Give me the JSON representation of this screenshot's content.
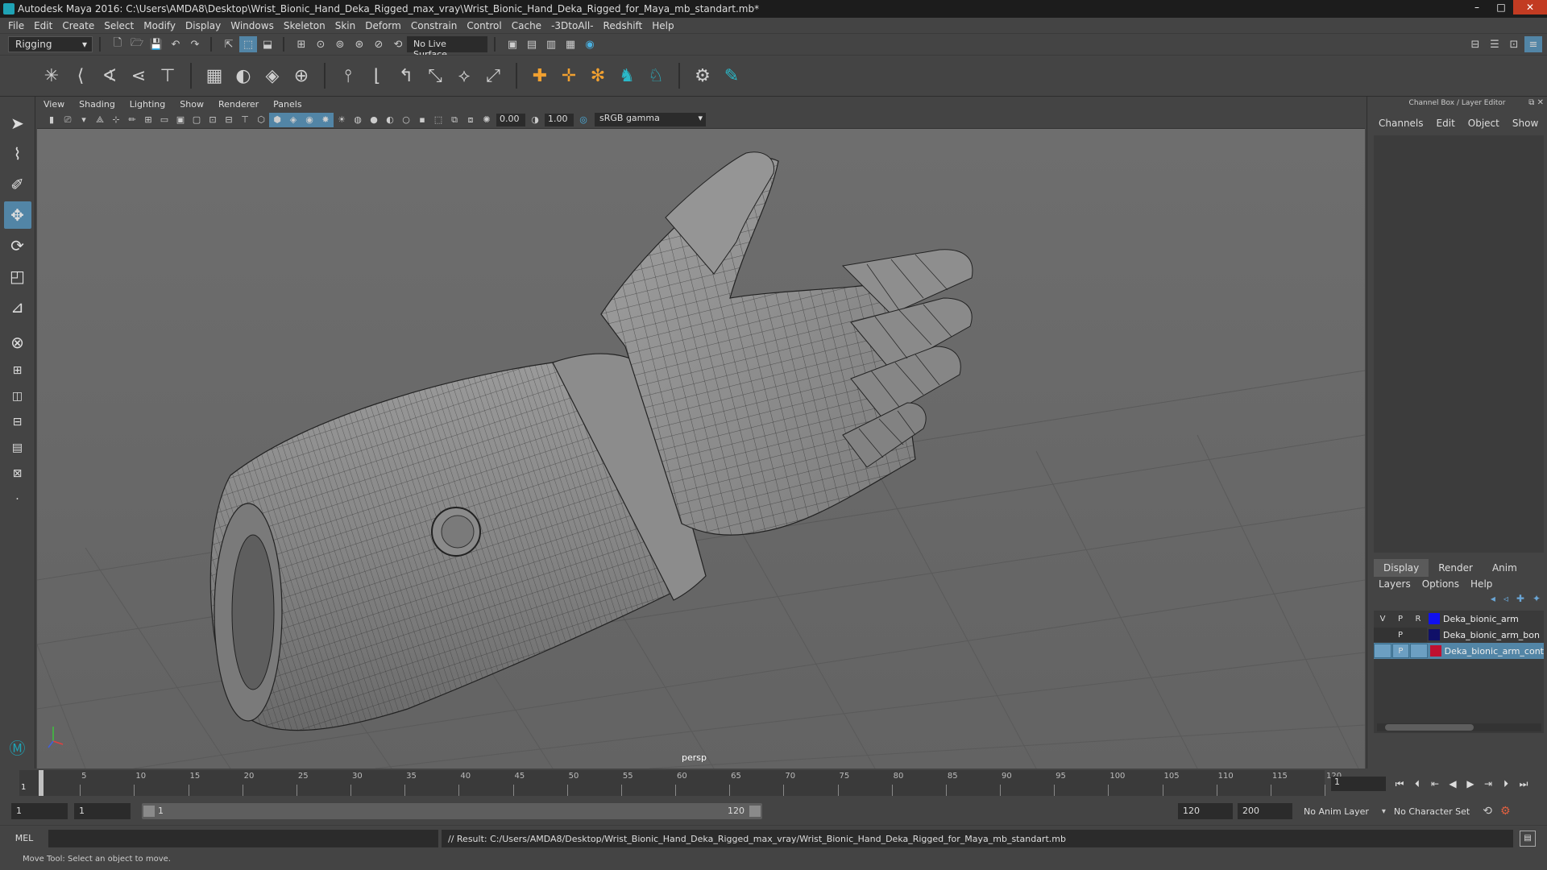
{
  "window": {
    "title": "Autodesk Maya 2016: C:\\Users\\AMDA8\\Desktop\\Wrist_Bionic_Hand_Deka_Rigged_max_vray\\Wrist_Bionic_Hand_Deka_Rigged_for_Maya_mb_standart.mb*",
    "minimize": "–",
    "maximize": "□",
    "close": "✕"
  },
  "menus": [
    "File",
    "Edit",
    "Create",
    "Select",
    "Modify",
    "Display",
    "Windows",
    "Skeleton",
    "Skin",
    "Deform",
    "Constrain",
    "Control",
    "Cache",
    "-3DtoAll-",
    "Redshift",
    "Help"
  ],
  "status_line": {
    "mode": "Rigging",
    "live_surface": "No Live Surface"
  },
  "viewport": {
    "menus": [
      "View",
      "Shading",
      "Lighting",
      "Show",
      "Renderer",
      "Panels"
    ],
    "exposure": "0.00",
    "gamma": "1.00",
    "color_space": "sRGB gamma",
    "camera": "persp"
  },
  "channel_box": {
    "header": "Channel Box / Layer Editor",
    "tabs": [
      "Channels",
      "Edit",
      "Object",
      "Show"
    ]
  },
  "layer_editor": {
    "tabs": [
      "Display",
      "Render",
      "Anim"
    ],
    "active_tab": "Display",
    "menus": [
      "Layers",
      "Options",
      "Help"
    ],
    "layers": [
      {
        "v": "V",
        "p": "P",
        "r": "R",
        "color": "#1010f0",
        "name": "Deka_bionic_arm",
        "selected": false
      },
      {
        "v": "",
        "p": "P",
        "r": "",
        "color": "#101068",
        "name": "Deka_bionic_arm_bon",
        "selected": false
      },
      {
        "v": "",
        "p": "P",
        "r": "",
        "color": "#c01030",
        "name": "Deka_bionic_arm_cont",
        "selected": true
      }
    ]
  },
  "time_slider": {
    "ticks": [
      "5",
      "10",
      "15",
      "20",
      "25",
      "30",
      "35",
      "40",
      "45",
      "50",
      "55",
      "60",
      "65",
      "70",
      "75",
      "80",
      "85",
      "90",
      "95",
      "100",
      "105",
      "110",
      "115",
      "120"
    ],
    "current_frame_label": "1",
    "current_frame": "1"
  },
  "range_slider": {
    "start_time": "1",
    "playback_start": "1",
    "range_start_label": "1",
    "range_end_label": "120",
    "playback_end": "120",
    "end_time": "200",
    "anim_layer": "No Anim Layer",
    "character_set": "No Character Set"
  },
  "command_line": {
    "language": "MEL",
    "result": "// Result: C:/Users/AMDA8/Desktop/Wrist_Bionic_Hand_Deka_Rigged_max_vray/Wrist_Bionic_Hand_Deka_Rigged_for_Maya_mb_standart.mb"
  },
  "help_line": "Move Tool: Select an object to move."
}
